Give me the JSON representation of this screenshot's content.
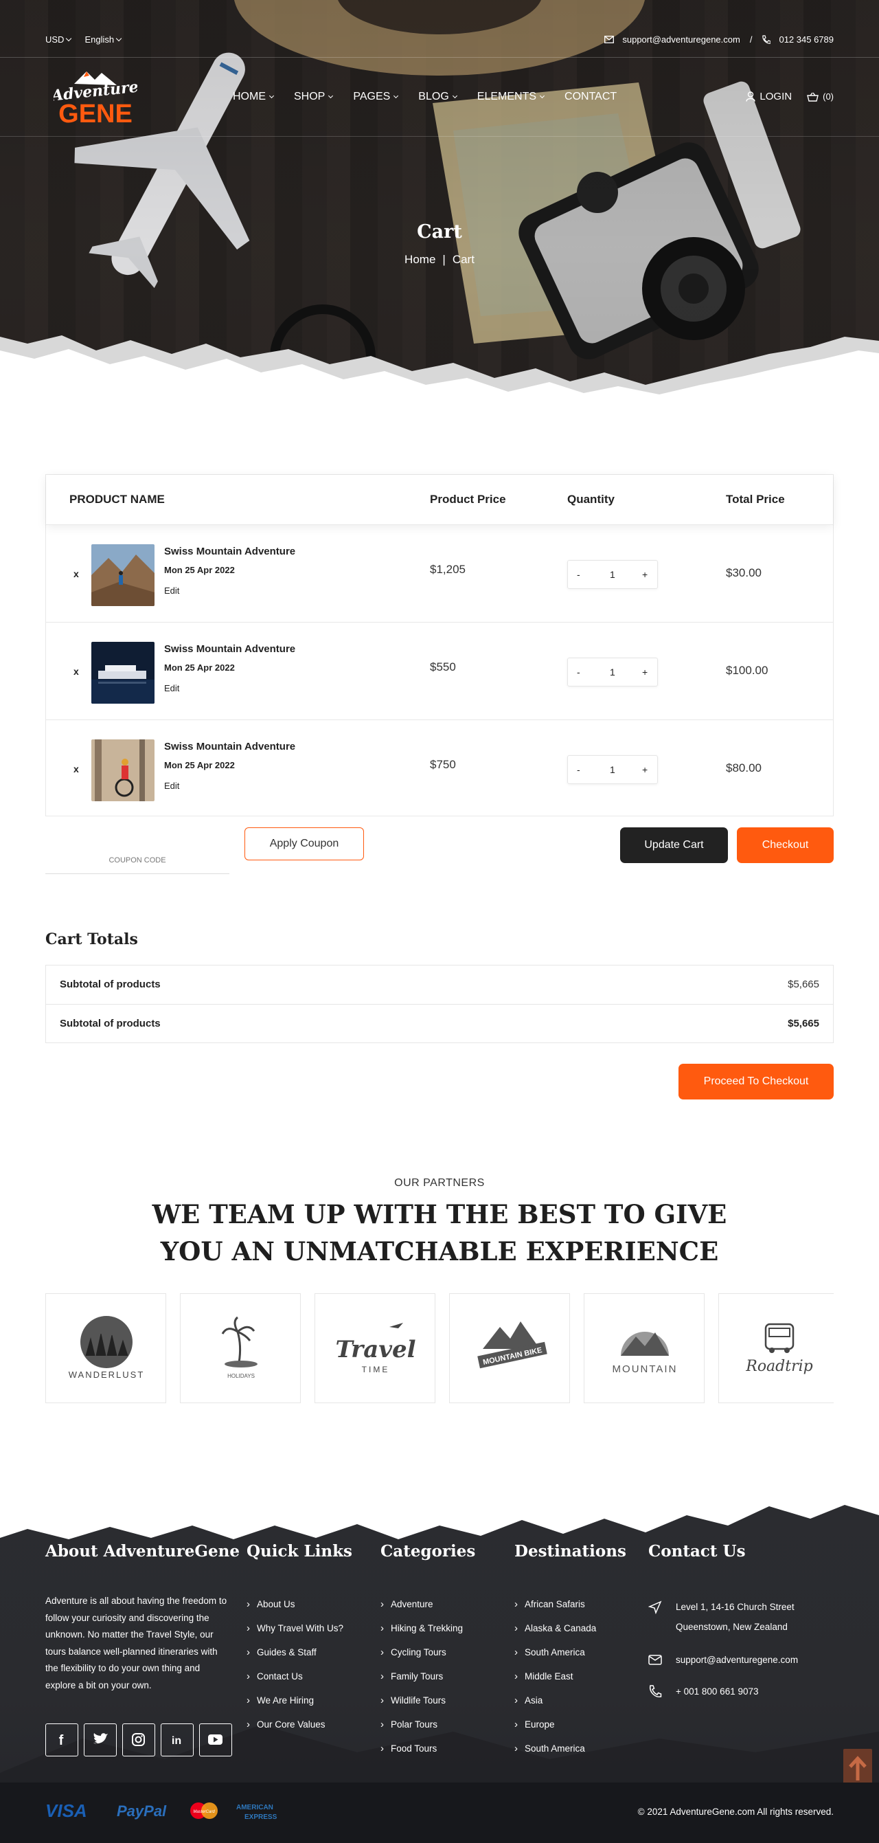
{
  "topbar": {
    "currency": "USD",
    "language": "English",
    "email": "support@adventuregene.com",
    "separator": "/",
    "phone": "012 345 6789"
  },
  "brand": {
    "logo_top": "Adventure",
    "logo_bottom": "GENE"
  },
  "nav": {
    "items": [
      "HOME",
      "SHOP",
      "PAGES",
      "BLOG",
      "ELEMENTS",
      "CONTACT"
    ],
    "login": "LOGIN",
    "cart_count": "(0)"
  },
  "hero": {
    "title": "Cart",
    "breadcrumb_home": "Home",
    "breadcrumb_sep": "|",
    "breadcrumb_current": "Cart"
  },
  "cart": {
    "headers": {
      "product": "PRODUCT NAME",
      "price": "Product Price",
      "quantity": "Quantity",
      "total": "Total Price"
    },
    "remove_label": "x",
    "minus": "-",
    "plus": "+",
    "edit_label": "Edit",
    "items": [
      {
        "name": "Swiss Mountain Adventure",
        "date": "Mon 25 Apr 2022",
        "price": "$1,205",
        "qty": "1",
        "total": "$30.00"
      },
      {
        "name": "Swiss Mountain Adventure",
        "date": "Mon 25 Apr 2022",
        "price": "$550",
        "qty": "1",
        "total": "$100.00"
      },
      {
        "name": "Swiss Mountain Adventure",
        "date": "Mon 25 Apr 2022",
        "price": "$750",
        "qty": "1",
        "total": "$80.00"
      }
    ],
    "coupon_placeholder": "COUPON CODE",
    "apply_coupon": "Apply Coupon",
    "update_cart": "Update Cart",
    "checkout": "Checkout"
  },
  "totals": {
    "title": "Cart Totals",
    "rows": [
      {
        "label": "Subtotal of products",
        "value": "$5,665"
      },
      {
        "label": "Subtotal of products",
        "value": "$5,665"
      }
    ],
    "proceed": "Proceed To Checkout"
  },
  "partners": {
    "kicker": "OUR PARTNERS",
    "title": "WE TEAM UP WITH THE BEST TO GIVE YOU AN UNMATCHABLE EXPERIENCE",
    "logos": [
      {
        "text": "WANDERLUST",
        "icon": "forest-badge-icon"
      },
      {
        "text": "HOLIDAYS",
        "icon": "palm-tree-icon"
      },
      {
        "text": "Travel",
        "sub": "TIME",
        "icon": "plane-script-icon"
      },
      {
        "text": "MOUNTAIN BIKE",
        "icon": "mountain-bike-icon"
      },
      {
        "text": "MOUNTAIN",
        "icon": "sunset-mountain-icon"
      },
      {
        "text": "Roadtrip",
        "icon": "van-icon"
      }
    ]
  },
  "footer": {
    "about_title": "About AdventureGene",
    "about_text": "Adventure is all about having the freedom to follow your curiosity and discovering the unknown. No matter the Travel Style, our tours balance well-planned itineraries with the flexibility to do your own thing and explore a bit on your own.",
    "quick_title": "Quick Links",
    "quick_links": [
      "About Us",
      "Why Travel With Us?",
      "Guides & Staff",
      "Contact Us",
      "We Are Hiring",
      "Our Core Values"
    ],
    "cat_title": "Categories",
    "categories": [
      "Adventure",
      "Hiking & Trekking",
      "Cycling Tours",
      "Family Tours",
      "Wildlife Tours",
      "Polar Tours",
      "Food Tours"
    ],
    "dest_title": "Destinations",
    "destinations": [
      "African Safaris",
      "Alaska & Canada",
      "South America",
      "Middle East",
      "Asia",
      "Europe",
      "South America"
    ],
    "contact_title": "Contact Us",
    "address_line1": "Level 1, 14-16 Church Street",
    "address_line2": "Queenstown, New Zealand",
    "email": "support@adventuregene.com",
    "phone": "+ 001 800 661 9073",
    "social": [
      "facebook-icon",
      "twitter-icon",
      "instagram-icon",
      "linkedin-icon",
      "youtube-icon"
    ],
    "payments": {
      "visa": "VISA",
      "paypal": "PayPal",
      "mastercard": "MasterCard",
      "amex_top": "AMERICAN",
      "amex_bottom": "EXPRESS"
    },
    "copyright": "© 2021 AdventureGene.com All rights reserved."
  },
  "colors": {
    "accent": "#ff5a0f",
    "dark": "#222222",
    "footer_bg": "#2a2b2f"
  }
}
